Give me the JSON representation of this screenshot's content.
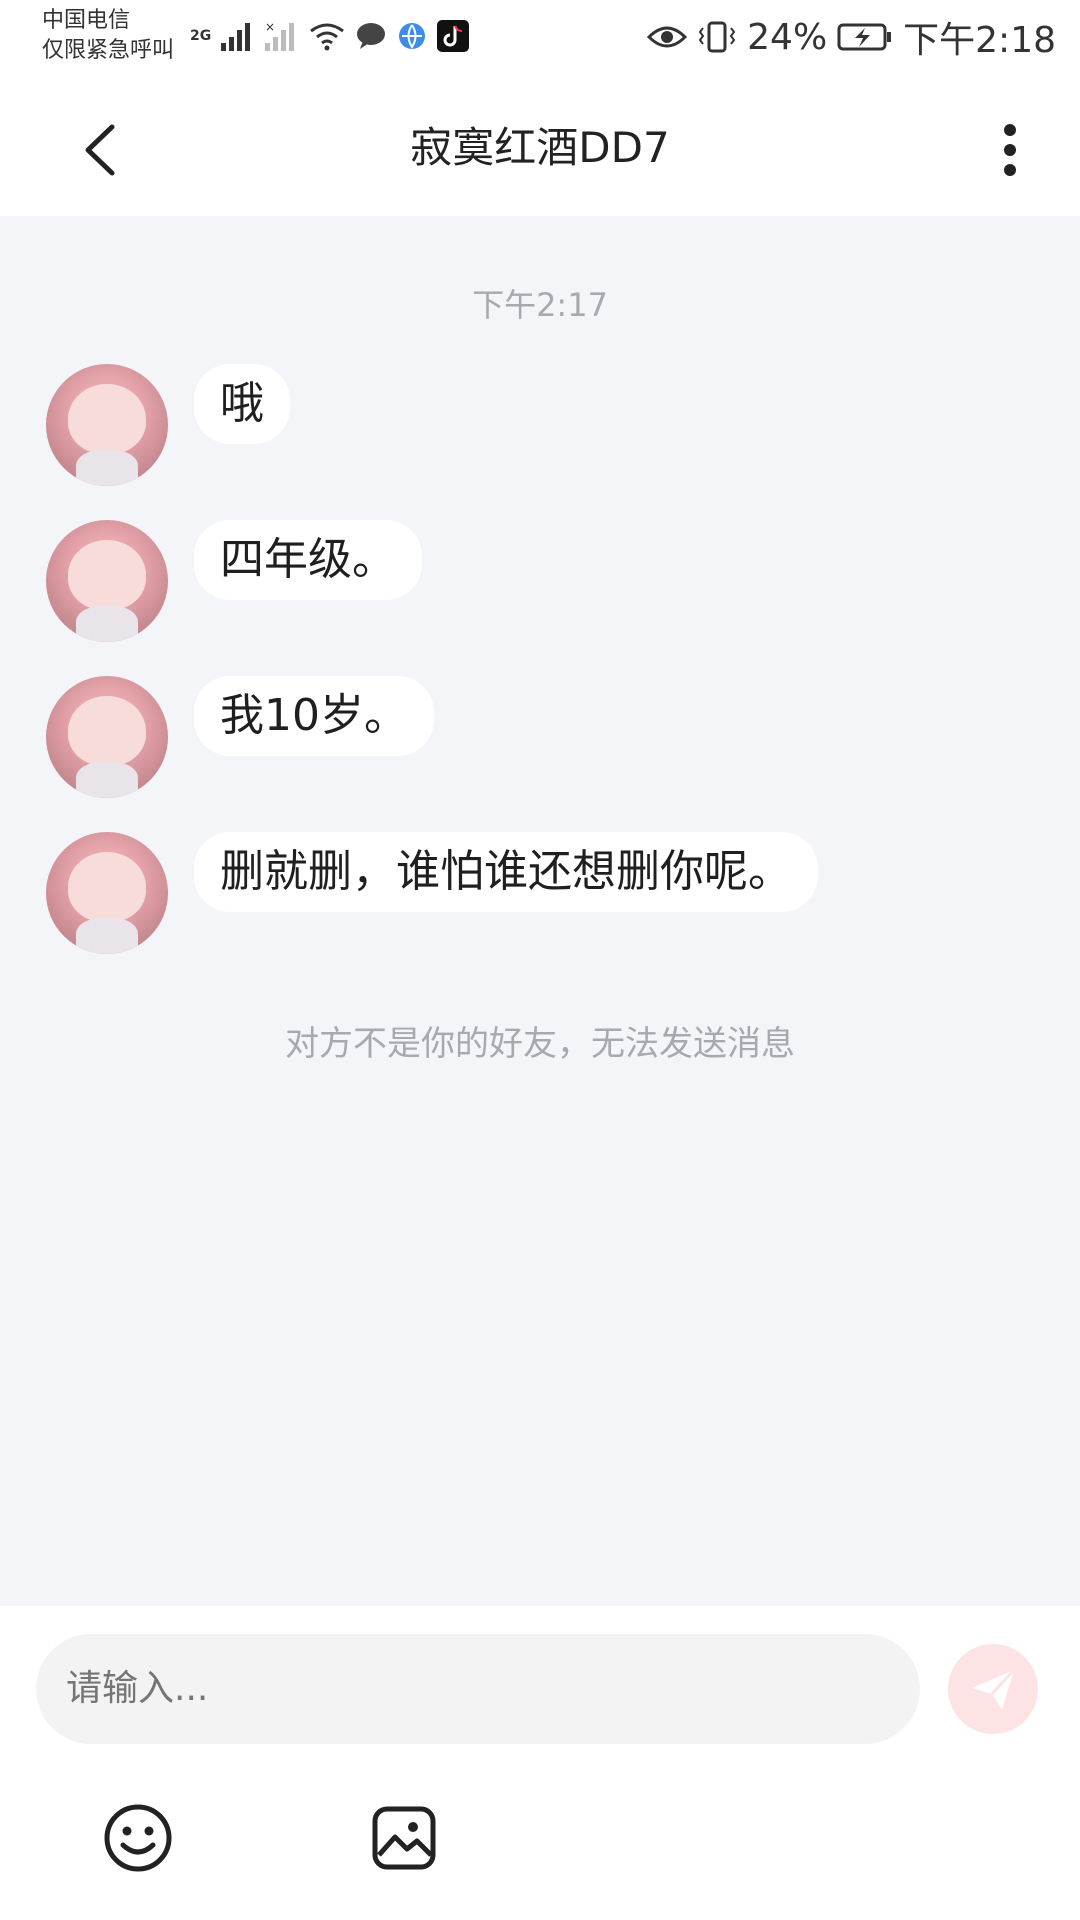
{
  "status_bar": {
    "carrier_line1": "中国电信",
    "carrier_line2": "仅限紧急呼叫",
    "network": "2G",
    "battery": "24%",
    "time": "下午2:18"
  },
  "header": {
    "title": "寂寞红酒DD7",
    "back_icon": "chevron-left-icon",
    "more_icon": "more-vertical-icon"
  },
  "chat": {
    "time_divider": "下午2:17",
    "messages": [
      {
        "text": "哦"
      },
      {
        "text": "四年级。"
      },
      {
        "text": "我10岁。"
      },
      {
        "text": "删就删，谁怕谁还想删你呢。"
      }
    ],
    "system_note": "对方不是你的好友，无法发送消息"
  },
  "composer": {
    "placeholder": "请输入...",
    "send_icon": "paper-plane-icon",
    "emoji_icon": "smiley-icon",
    "image_icon": "image-icon"
  },
  "colors": {
    "chat_bg": "#f4f5f8",
    "send_bg": "#fde3e3",
    "send_icon": "#ffffff",
    "muted_text": "#a7a9ae"
  }
}
